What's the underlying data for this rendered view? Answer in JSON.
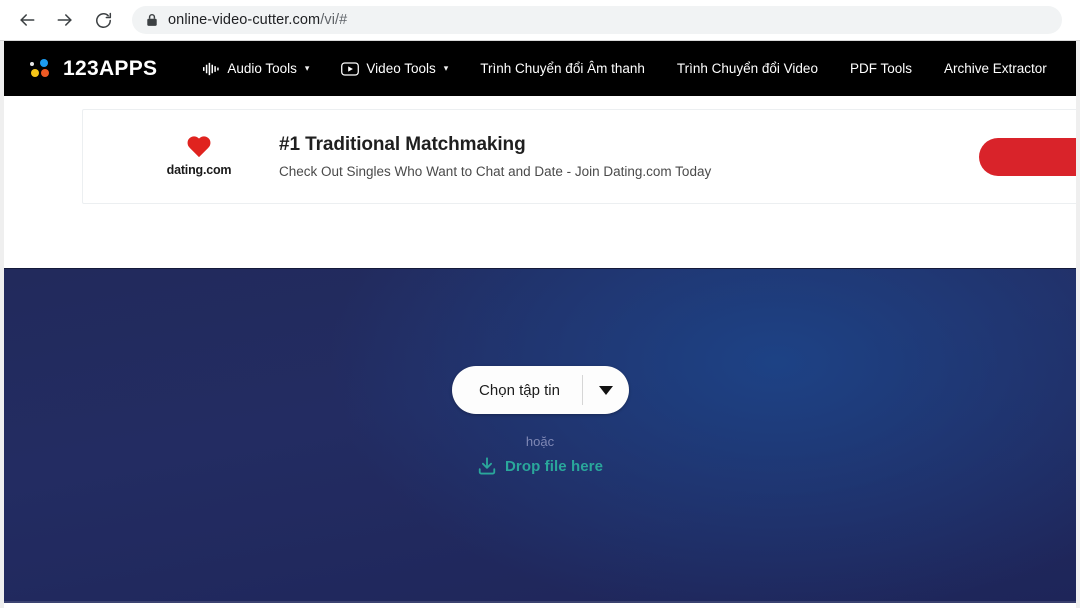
{
  "browser": {
    "back_icon": "arrow-left-icon",
    "forward_icon": "arrow-right-icon",
    "reload_icon": "reload-icon",
    "lock_icon": "lock-icon",
    "url_domain": "online-video-cutter.com",
    "url_path": "/vi/#",
    "url_full": "online-video-cutter.com/vi/#"
  },
  "site_nav": {
    "logo_text": "123APPS",
    "logo_dot_colors": [
      "#1d9bf0",
      "#f5c518",
      "#ee5a24"
    ],
    "items": [
      {
        "label": "Audio Tools",
        "icon": "audio-waveform-icon",
        "caret": "▾"
      },
      {
        "label": "Video Tools",
        "icon": "video-play-icon",
        "caret": "▾"
      },
      {
        "label": "Trình Chuyển đổi Âm thanh",
        "icon": "",
        "caret": ""
      },
      {
        "label": "Trình Chuyển đổi Video",
        "icon": "",
        "caret": ""
      },
      {
        "label": "PDF Tools",
        "icon": "",
        "caret": ""
      },
      {
        "label": "Archive Extractor",
        "icon": "",
        "caret": ""
      }
    ],
    "background": "#000000"
  },
  "ad": {
    "brand": "dating.com",
    "brand_icon": "heart-icon",
    "title": "#1 Traditional Matchmaking",
    "subtitle": "Check Out Singles Who Want to Chat and Date - Join Dating.com Today",
    "cta_color": "#d9232a",
    "cta_label": ""
  },
  "hero": {
    "file_button_label": "Chọn tập tin",
    "file_button_caret": "▼",
    "or_label": "hoặc",
    "drop_label": "Drop file here",
    "drop_icon": "download-tray-icon",
    "drop_color": "#2aa79b",
    "background_color": "#232c62"
  }
}
